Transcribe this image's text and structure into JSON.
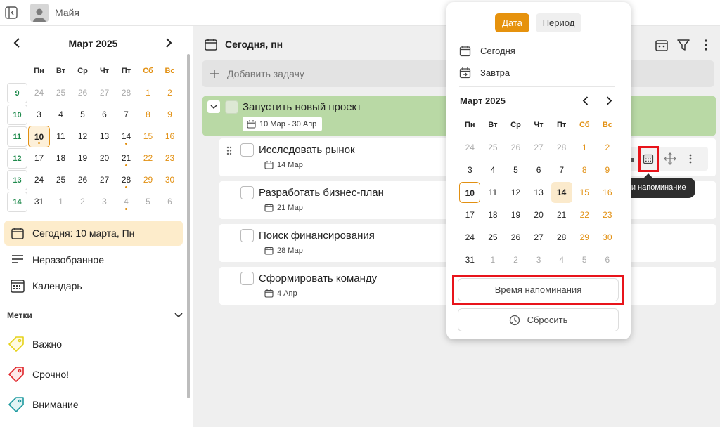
{
  "topbar": {
    "user_name": "Майя"
  },
  "sidebar": {
    "mini_calendar": {
      "title": "Март 2025",
      "weekdays": [
        "Пн",
        "Вт",
        "Ср",
        "Чт",
        "Пт",
        "Сб",
        "Вс"
      ],
      "weeks": [
        {
          "num": "9",
          "days": [
            "24",
            "25",
            "26",
            "27",
            "28",
            "1",
            "2"
          ]
        },
        {
          "num": "10",
          "days": [
            "3",
            "4",
            "5",
            "6",
            "7",
            "8",
            "9"
          ]
        },
        {
          "num": "11",
          "days": [
            "10",
            "11",
            "12",
            "13",
            "14",
            "15",
            "16"
          ]
        },
        {
          "num": "12",
          "days": [
            "17",
            "18",
            "19",
            "20",
            "21",
            "22",
            "23"
          ]
        },
        {
          "num": "13",
          "days": [
            "24",
            "25",
            "26",
            "27",
            "28",
            "29",
            "30"
          ]
        },
        {
          "num": "14",
          "days": [
            "31",
            "1",
            "2",
            "3",
            "4",
            "5",
            "6"
          ]
        }
      ]
    },
    "nav": {
      "today": "Сегодня: 10 марта, Пн",
      "inbox": "Неразобранное",
      "calendar": "Календарь"
    },
    "labels_title": "Метки",
    "labels": [
      {
        "name": "Важно",
        "color": "#e6d21a"
      },
      {
        "name": "Срочно!",
        "color": "#e0262b"
      },
      {
        "name": "Внимание",
        "color": "#1e9aa0"
      }
    ]
  },
  "main": {
    "title": "Сегодня, пн",
    "add_task_placeholder": "Добавить задачу",
    "parent_task": {
      "title": "Запустить новый проект",
      "dates": "10 Мар - 30 Апр",
      "color": "#b9d9a5"
    },
    "subtasks": [
      {
        "title": "Исследовать рынок",
        "date": "14 Мар"
      },
      {
        "title": "Разработать бизнес-план",
        "date": "21 Мар"
      },
      {
        "title": "Поиск финансирования",
        "date": "28 Мар"
      },
      {
        "title": "Сформировать команду",
        "date": "4 Апр"
      }
    ]
  },
  "popup": {
    "tab_date": "Дата",
    "tab_period": "Период",
    "quick_today": "Сегодня",
    "quick_tomorrow": "Завтра",
    "calendar_title": "Март 2025",
    "weekdays": [
      "Пн",
      "Вт",
      "Ср",
      "Чт",
      "Пт",
      "Сб",
      "Вс"
    ],
    "weeks": [
      [
        "24",
        "25",
        "26",
        "27",
        "28",
        "1",
        "2"
      ],
      [
        "3",
        "4",
        "5",
        "6",
        "7",
        "8",
        "9"
      ],
      [
        "10",
        "11",
        "12",
        "13",
        "14",
        "15",
        "16"
      ],
      [
        "17",
        "18",
        "19",
        "20",
        "21",
        "22",
        "23"
      ],
      [
        "24",
        "25",
        "26",
        "27",
        "28",
        "29",
        "30"
      ],
      [
        "31",
        "1",
        "2",
        "3",
        "4",
        "5",
        "6"
      ]
    ],
    "reminder_button": "Время напоминания",
    "reset_button": "Сбросить",
    "accent_color": "#e6920d"
  },
  "tooltip": "Дата и напоминание"
}
